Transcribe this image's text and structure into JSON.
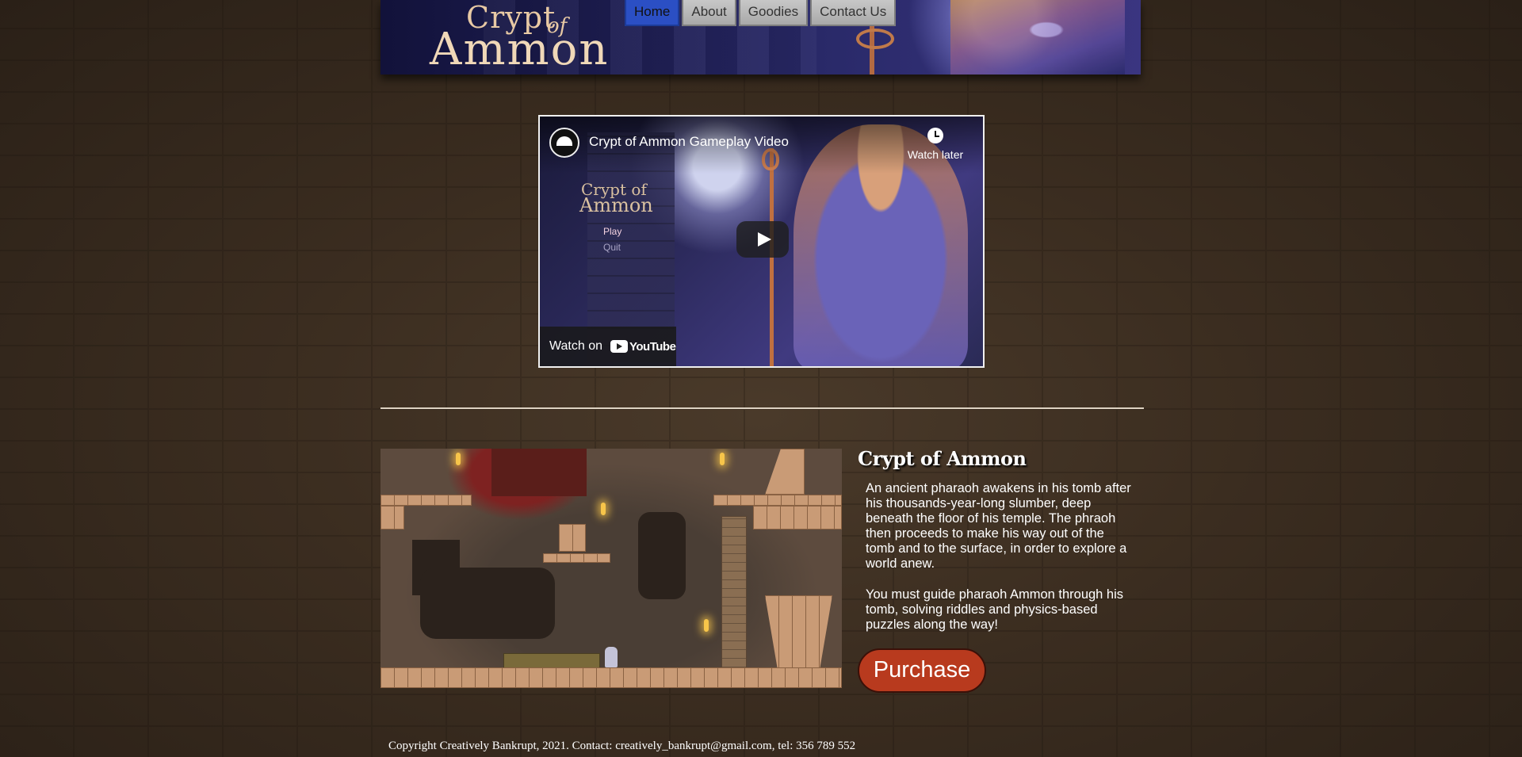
{
  "header": {
    "logo": {
      "top": "Crypt",
      "of": "of",
      "main": "Ammon"
    },
    "nav": [
      {
        "label": "Home",
        "active": true
      },
      {
        "label": "About",
        "active": false
      },
      {
        "label": "Goodies",
        "active": false
      },
      {
        "label": "Contact Us",
        "active": false
      }
    ]
  },
  "video": {
    "title": "Crypt of Ammon Gameplay Video",
    "watch_later": "Watch later",
    "watch_on": "Watch on",
    "youtube": "YouTube",
    "thumb_logo_top": "Crypt of",
    "thumb_logo_main": "Ammon",
    "thumb_menu_play": "Play",
    "thumb_menu_quit": "Quit"
  },
  "game": {
    "title": "Crypt of Ammon",
    "paragraphs": [
      "An ancient pharaoh awakens in his tomb after his thousands-year-long slumber, deep beneath the floor of his temple. The phraoh then proceeds to make his way out of the tomb and to the surface, in order to explore a world anew.",
      "You must guide pharaoh Ammon through his tomb, solving riddles and physics-based puzzles along the way!"
    ],
    "purchase_label": "Purchase"
  },
  "footer": {
    "text": "Copyright Creatively Bankrupt, 2021. Contact: creatively_bankrupt@gmail.com, tel: 356 789 552"
  },
  "colors": {
    "nav_active": "#2b4fc4",
    "purchase_button": "#b83a1e",
    "background": "#3b2d20"
  }
}
